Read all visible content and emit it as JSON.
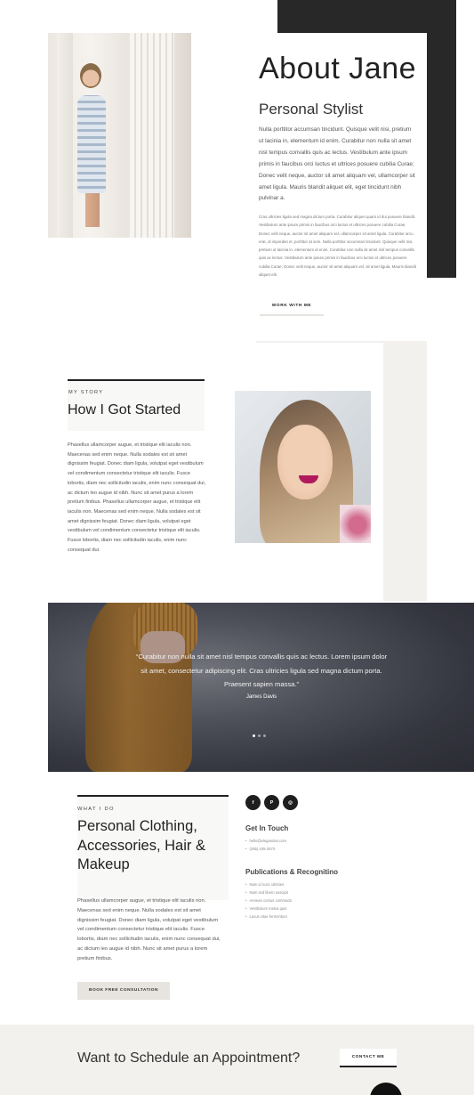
{
  "about": {
    "title": "About Jane",
    "subtitle": "Personal Stylist",
    "paragraph1": "Nulla porttitor accumsan tincidunt. Quisque velit nisi, pretium ut lacinia in, elementum id enim. Curabitur non nulla sit amet nisl tempus convallis quis ac lectus. Vestibulum ante ipsum primis in faucibus orci luctus et ultrices posuere cubilia Curae; Donec velit neque, auctor sit amet aliquam vel, ullamcorper sit amet ligula. Mauris blandit aliquet elit, eget tincidunt nibh pulvinar a.",
    "paragraph2": "Cras ultricies ligula sed magna dictum porta. Curabitur aliquet quam id dui posuere blandit. Vestibulum ante ipsum primis in faucibus orci luctus et ultrices posuere cubilia Curae; Donec velit neque, auctor sit amet aliquam vel, ullamcorper sit amet ligula. Curabitur arcu erat, id imperdiet et, porttitor at sem. Nulla porttitor accumsan tincidunt. Quisque velit nisi, pretium ut lacinia in, elementum id enim. Curabitur non nulla sit amet nisl tempus convallis quis ac lectus. Vestibulum ante ipsum primis in faucibus orci luctus et ultrices posuere cubilia Curae; Donec velit neque, auctor sit amet aliquam vel, sit amet ligula. Mauris blandit aliquet elit.",
    "button": "WORK WITH ME"
  },
  "story": {
    "tag": "MY STORY",
    "title": "How I Got Started",
    "paragraph": "Phasellus ullamcorper augue, et tristique elit iaculis non. Maecenas sed enim neque. Nulla sodales est sit amet dignissim feugiat. Donec diam ligula, volutpat eget vestibulum vel condimentum consectetur tristique elit iaculis. Fusce lobortis, diam nec sollicitudin iaculis, enim nunc consequat dui, ac dictum leo augue id nibh. Nunc sit amet purus a lorem pretium finibus. Phasellus ullamcorper augue, et tristique elit iaculis non. Maecenas sed enim neque. Nulla sodales est sit amet dignissim feugiat. Donec diam ligula, volutpat eget vestibulum vel condimentum consectetur tristique elit iaculis. Fusce lobortis, diam nec sollicitudin iaculis, enim nunc consequat dui."
  },
  "testimonial": {
    "quote": "“Curabitur non nulla sit amet nisl tempus convallis quis ac lectus. Lorem ipsum dolor sit amet, consectetur adipiscing elit. Cras ultricies ligula sed magna dictum porta. Praesent sapien massa.”",
    "author": "James Davis",
    "slides": 3,
    "active_slide": 1
  },
  "what_i_do": {
    "tag": "WHAT I DO",
    "title": "Personal Clothing, Accessories, Hair & Makeup",
    "paragraph": "Phasellus ullamcorper augue, et tristique elit iaculis non. Maecenas sed enim neque. Nulla sodales est sit amet dignissim feugiat. Donec diam ligula, volutpat eget vestibulum vel condimentum consectetur tristique elit iaculis. Fusce lobortis, diam nec sollicitudin iaculis, enim nunc consequat dui, ac dictum leo augue id nibh. Nunc sit amet purus a lorem pretium finibus.",
    "button": "BOOK FREE CONSULTATION"
  },
  "social": [
    {
      "icon": "facebook-icon",
      "glyph": "f"
    },
    {
      "icon": "pinterest-icon",
      "glyph": "P"
    },
    {
      "icon": "instagram-icon",
      "glyph": "◎"
    }
  ],
  "contact": {
    "heading": "Get In Touch",
    "items": [
      "hello@elegandes.com",
      "(255) 435-2573"
    ]
  },
  "publications": {
    "heading": "Publications & Recognitino",
    "items": [
      "Nam id nunc ultricies",
      "Nam sed libero suscipit",
      "Aenean cursus commodo",
      "Vestibulum metus quis",
      "Lacus vitae fermentum"
    ]
  },
  "cta": {
    "title": "Want to Schedule an Appointment?",
    "button": "CONTACT ME"
  },
  "colors": {
    "dark": "#282828",
    "beige": "#f3f1ee",
    "button_beige": "#e7e4df",
    "lipstick": "#b01a5c",
    "sweater": "#b77b2c"
  }
}
